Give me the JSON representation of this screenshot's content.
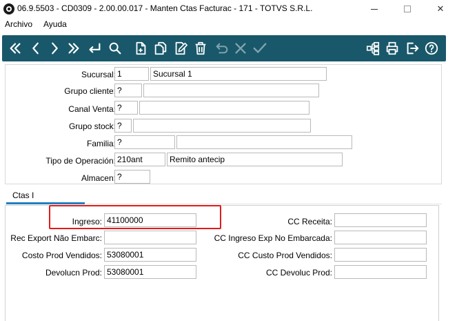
{
  "window": {
    "title": "06.9.5503 - CD0309 - 2.00.00.017 - Manten Ctas Facturac - 171 - TOTVS S.R.L.",
    "close_glyph": "✕"
  },
  "menu": {
    "items": [
      "Archivo",
      "Ayuda"
    ]
  },
  "toolbar": {
    "color": "#19586a",
    "icon_color": "#ffffff",
    "buttons": [
      {
        "name": "first-record-icon"
      },
      {
        "name": "previous-record-icon"
      },
      {
        "name": "next-record-icon"
      },
      {
        "name": "last-record-icon"
      },
      {
        "name": "goto-icon"
      },
      {
        "name": "search-icon"
      },
      {
        "name": "new-icon"
      },
      {
        "name": "copy-icon"
      },
      {
        "name": "edit-icon"
      },
      {
        "name": "delete-icon"
      },
      {
        "name": "undo-icon",
        "disabled": true
      },
      {
        "name": "cancel-icon",
        "disabled": true
      },
      {
        "name": "save-icon",
        "disabled": true
      },
      {
        "name": "tree-icon"
      },
      {
        "name": "print-icon"
      },
      {
        "name": "exit-icon"
      },
      {
        "name": "help-icon"
      }
    ]
  },
  "header": {
    "sucursal": {
      "label": "Sucursal:",
      "code": "1",
      "description": "Sucursal 1"
    },
    "grupo_cliente": {
      "label": "Grupo cliente:",
      "code": "?",
      "description": ""
    },
    "canal_venta": {
      "label": "Canal Venta:",
      "code": "?",
      "description": ""
    },
    "grupo_stock": {
      "label": "Grupo stock:",
      "code": "?",
      "description": ""
    },
    "familia": {
      "label": "Familia:",
      "code": "?",
      "description": ""
    },
    "tipo_operacion": {
      "label": "Tipo de Operación:",
      "code": "210ant",
      "description": "Remito antecip"
    },
    "almacen": {
      "label": "Almacen:",
      "code": "?"
    }
  },
  "tabs": {
    "items": [
      {
        "label": "Ctas I",
        "active": true
      }
    ],
    "active_color": "#1f7fc1"
  },
  "detail": {
    "ingreso": {
      "label": "Ingreso:",
      "value": "41100000"
    },
    "rec_export": {
      "label": "Rec Export Não Embarc:",
      "value": ""
    },
    "costo_prod": {
      "label": "Costo Prod Vendidos:",
      "value": "53080001"
    },
    "devolucn_prod": {
      "label": "Devolucn Prod:",
      "value": "53080001"
    },
    "cc_receita": {
      "label": "CC Receita:",
      "value": ""
    },
    "cc_ingreso_exp": {
      "label": "CC Ingreso Exp No Embarcada:",
      "value": ""
    },
    "cc_custo_prod": {
      "label": "CC Custo Prod Vendidos:",
      "value": ""
    },
    "cc_devoluc_prod": {
      "label": "CC Devoluc Prod:",
      "value": ""
    }
  },
  "highlight_color": "#e01b1b"
}
